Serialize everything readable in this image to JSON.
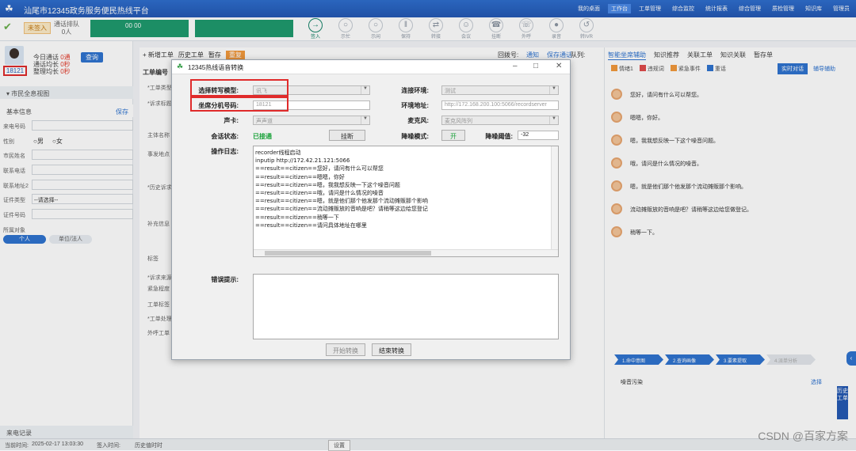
{
  "app": {
    "title": "汕尾市12345政务服务便民热线平台",
    "nav": [
      "我的桌面",
      "工作台",
      "工单管理",
      "综合监控",
      "统计报表",
      "综合管理",
      "质检管理",
      "知识库",
      "管理员"
    ],
    "active_nav": "工作台"
  },
  "toolbar": {
    "status": "未签入",
    "call_wait": "通话排队",
    "call_count": "0人",
    "timer": "00 00",
    "tools": [
      "签入",
      "示忙",
      "示闲",
      "保持",
      "转接",
      "会议",
      "挂断",
      "外呼",
      "录音",
      "转IVR"
    ]
  },
  "agent": {
    "id": "18121",
    "today_calls_label": "今日通话",
    "today_calls": "0通",
    "avg_call_label": "通话均长",
    "avg_call": "0秒",
    "avg_wrap_label": "整理均长",
    "avg_wrap": "0秒",
    "query": "查询"
  },
  "left": {
    "section_citizen": "市民全息视图",
    "section_basic": "基本信息",
    "save": "保存",
    "fields": [
      "来电号码",
      "性别",
      "市民姓名",
      "联系电话",
      "联系地址2",
      "证件类型",
      "证件号码",
      "所属对象"
    ],
    "gender_male": "男",
    "gender_female": "女",
    "id_type_value": "--请选择--",
    "person_btn": "个人",
    "enterprise_btn": "单位/法人",
    "bottom_label": "来电记录"
  },
  "center": {
    "tabs": [
      "+ 新增工单",
      "历史工单",
      "暂存",
      "重复"
    ],
    "order_no": "工单编号",
    "labels": [
      "*工单类型",
      "*诉求标题",
      "主体名称",
      "事发地点",
      "*历史诉求",
      "补充信息",
      "标签",
      "*诉求来源",
      "紧急程度",
      "工单标签",
      "*工单处理",
      "外呼工单"
    ],
    "recall_label": "回拨号:",
    "recall_value": "通知",
    "recall_btn": "保存通话",
    "queue_label": "队列:"
  },
  "right": {
    "tabs": [
      "智能坐席辅助",
      "知识推荐",
      "关联工单",
      "知识关联",
      "暂存单"
    ],
    "active_tab": "智能坐席辅助",
    "subtabs": [
      "情绪1",
      "违规词",
      "紧急事件",
      "重话"
    ],
    "btn_live": "实时对话",
    "btn_assist": "辅导辅助",
    "chat": [
      "您好，请问有什么可以帮您。",
      "嗯嗯，你好。",
      "嗯，我我想反映一下这个噪音问题。",
      "哦，请问是什么情况的噪音。",
      "嗯，就是他们那个他发那个流动摊贩那个影响。",
      "流动摊贩放的音响是吧？请稍等这边给您做登记。",
      "稍等一下。"
    ],
    "steps": [
      "1.命中意图",
      "2.查询画像",
      "3.要素提取",
      "4.派单分析"
    ],
    "bottom_item": "噪音污染",
    "bottom_action": "选择",
    "side_tab": "历史工单"
  },
  "statusbar": {
    "logon_time_label": "当前时间:",
    "logon_time": "2025-02-17 13:03:30",
    "signin_label": "签入时间:",
    "signin_value": "历史值时时",
    "setting": "设置"
  },
  "dialog": {
    "title": "12345热线语音转换",
    "model_label": "选择转写模型:",
    "model_value": "讯飞",
    "env_label": "连接环境:",
    "env_value": "测试",
    "ext_label": "坐席分机号码:",
    "ext_value": "18121",
    "addr_label": "环境地址:",
    "addr_value": "http://172.168.200.100:5066/recordserver",
    "soundcard_label": "声卡:",
    "soundcard_value": "声声道",
    "mic_label": "麦克风:",
    "mic_value": "麦克风阵列",
    "session_label": "会话状态:",
    "session_value": "已接通",
    "hangup_btn": "挂断",
    "noise_label": "降噪模式:",
    "noise_value": "开",
    "noise_thresh_label": "降噪阈值:",
    "noise_thresh_value": "-32",
    "log_label": "操作日志:",
    "log_lines": [
      "recorder线程启动",
      "inputip  http://172.42.21.121:5066",
      "==result==citizen==您好，请问有什么可以帮您",
      "==result==citizen==嗯嗯，你好",
      "==result==citizen==嗯，我我想反映一下这个噪音问题",
      "==result==citizen==哦，请问是什么情况的噪音",
      "==result==citizen==嗯，就是他们那个他发那个流动摊贩那个影响",
      "==result==citizen==流动摊贩放的音响是吧？请稍等这边给您登记",
      "==result==citizen==稍等一下",
      "==result==citizen==请问具体地址在哪里"
    ],
    "err_label": "错误提示:",
    "start_btn": "开始转换",
    "stop_btn": "结束转换"
  },
  "watermark": "CSDN @百家方案"
}
